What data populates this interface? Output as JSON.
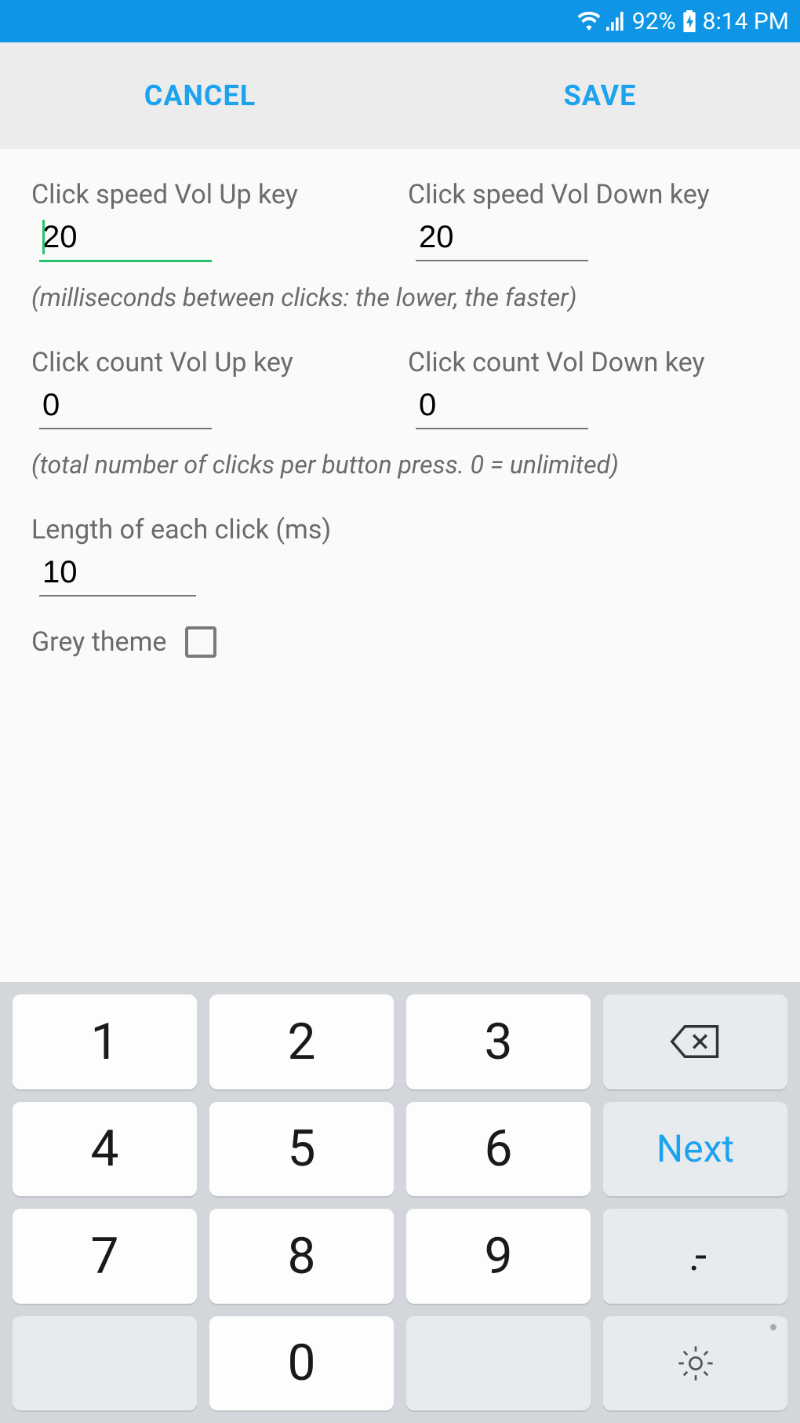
{
  "status": {
    "battery_pct": "92%",
    "time": "8:14 PM"
  },
  "actions": {
    "cancel": "CANCEL",
    "save": "SAVE"
  },
  "fields": {
    "speed_up_label": "Click speed Vol Up key",
    "speed_up_value": "20",
    "speed_down_label": "Click speed Vol Down key",
    "speed_down_value": "20",
    "speed_hint": "(milliseconds between clicks: the lower, the faster)",
    "count_up_label": "Click count Vol Up key",
    "count_up_value": "0",
    "count_down_label": "Click count Vol Down key",
    "count_down_value": "0",
    "count_hint": "(total number of clicks per button press. 0 = unlimited)",
    "length_label": "Length of each click (ms)",
    "length_value": "10",
    "grey_theme_label": "Grey theme"
  },
  "keyboard": {
    "k1": "1",
    "k2": "2",
    "k3": "3",
    "k4": "4",
    "k5": "5",
    "k6": "6",
    "k7": "7",
    "k8": "8",
    "k9": "9",
    "k0": "0",
    "next": "Next",
    "sym": ".-"
  }
}
